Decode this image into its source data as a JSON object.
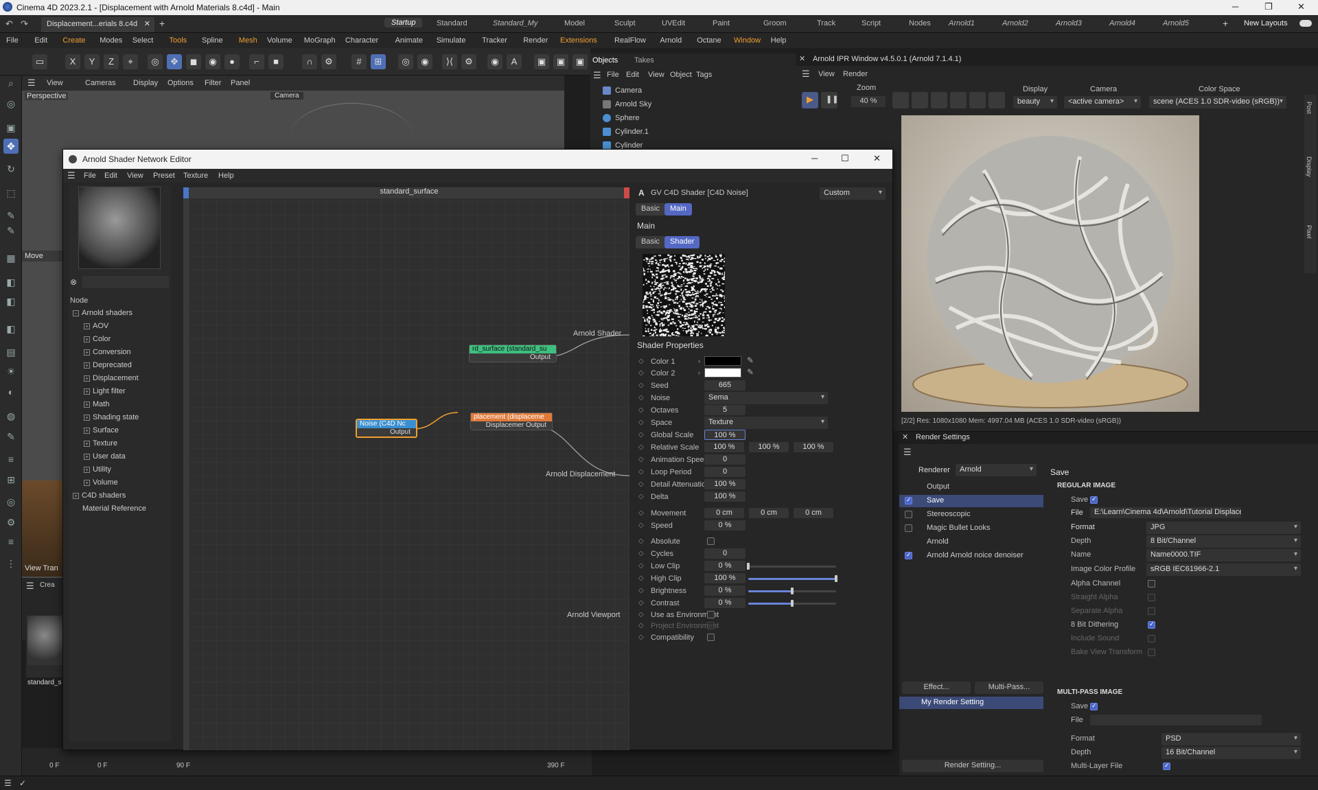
{
  "window_title": "Cinema 4D 2023.2.1 - [Displacement with Arnold Materials 8.c4d] - Main",
  "doc_tab": "Displacement...erials 8.c4d",
  "layouts": [
    "Startup",
    "Standard",
    "Standard_My",
    "Model",
    "Sculpt",
    "UVEdit",
    "Paint",
    "Groom",
    "Track",
    "Script",
    "Nodes",
    "Arnold1",
    "Arnold2",
    "Arnold3",
    "Arnold4",
    "Arnold5"
  ],
  "new_layouts": "New Layouts",
  "menu": [
    "File",
    "Edit",
    "Create",
    "Modes",
    "Select",
    "Tools",
    "Spline",
    "Mesh",
    "Volume",
    "MoGraph",
    "Character",
    "Animate",
    "Simulate",
    "Tracker",
    "Render",
    "Extensions",
    "RealFlow",
    "Arnold",
    "Octane",
    "Window",
    "Help"
  ],
  "viewport": {
    "menu": [
      "View",
      "Cameras",
      "Display",
      "Options",
      "Filter",
      "Panel"
    ],
    "label": "Perspective",
    "camera_tag": "Camera",
    "move_label": "Move",
    "view_tran": "View Tran",
    "create_label": "Crea",
    "mat_label": "standard_s"
  },
  "objects": {
    "tabs": [
      "Objects",
      "Takes"
    ],
    "menu": [
      "File",
      "Edit",
      "View",
      "Object",
      "Tags"
    ],
    "rows": [
      "Camera",
      "Arnold Sky",
      "Sphere",
      "Cylinder.1",
      "Cylinder"
    ]
  },
  "ipr": {
    "title": "Arnold IPR Window v4.5.0.1 (Arnold 7.1.4.1)",
    "menu": [
      "View",
      "Render"
    ],
    "zoom_label": "Zoom",
    "zoom_value": "40 %",
    "display_label": "Display",
    "display_value": "beauty",
    "camera_label": "Camera",
    "camera_value": "<active camera>",
    "colorspace_label": "Color Space",
    "colorspace_value": "scene (ACES 1.0 SDR-video (sRGB))",
    "status": "[2/2]  Res: 1080x1080  Mem: 4997.04 MB  (ACES 1.0 SDR-video (sRGB))",
    "side_tabs": [
      "Post",
      "Display",
      "Pixel"
    ]
  },
  "render_settings": {
    "title": "Render Settings",
    "renderer_label": "Renderer",
    "renderer_value": "Arnold",
    "items": [
      "Output",
      "Save",
      "Stereoscopic",
      "Magic Bullet Looks",
      "Arnold",
      "Arnold Arnold noice denoiser"
    ],
    "effect_btn": "Effect...",
    "multipass_btn": "Multi-Pass...",
    "setting_name": "My Render Setting",
    "render_setting_btn": "Render Setting...",
    "save_title": "Save",
    "regular_image": "REGULAR IMAGE",
    "save_label": "Save",
    "file_label": "File",
    "file_value": "E:\\Learn\\Cinema 4d\\Arnold\\Tutorial Displacement wi",
    "format_label": "Format",
    "format_value": "JPG",
    "depth_label": "Depth",
    "depth_value": "8 Bit/Channel",
    "name_label": "Name",
    "name_value": "Name0000.TIF",
    "icp_label": "Image Color Profile",
    "icp_value": "sRGB IEC61966-2.1",
    "alpha_channel": "Alpha Channel",
    "straight_alpha": "Straight Alpha",
    "separate_alpha": "Separate Alpha",
    "dithering": "8 Bit Dithering",
    "include_sound": "Include Sound",
    "bake_view": "Bake View Transform",
    "multipass_image": "MULTI-PASS IMAGE",
    "mp_save": "Save",
    "mp_file": "File",
    "mp_format_label": "Format",
    "mp_format_value": "PSD",
    "mp_depth_label": "Depth",
    "mp_depth_value": "16 Bit/Channel",
    "mp_multilayer": "Multi-Layer File"
  },
  "shader_editor": {
    "title": "Arnold Shader Network Editor",
    "menu": [
      "File",
      "Edit",
      "View",
      "Preset",
      "Texture",
      "Help"
    ],
    "node_header": "Node",
    "tree": {
      "root": "Arnold shaders",
      "children": [
        "AOV",
        "Color",
        "Conversion",
        "Deprecated",
        "Displacement",
        "Light filter",
        "Math",
        "Shading state",
        "Surface",
        "Texture",
        "User data",
        "Utility",
        "Volume"
      ],
      "c4d": "C4D shaders",
      "matref": "Material Reference"
    },
    "graph_title": "standard_surface",
    "nodes": {
      "surface_title": "rd_surface (standard_su",
      "surface_out": "Output",
      "disp_title": "placement (displaceme",
      "disp_out": "Displacemer Output",
      "noise_title": "Noise (C4D Nc",
      "noise_out": "Output"
    },
    "ports": [
      "Arnold Shader",
      "Arnold Displacement",
      "Arnold Viewport"
    ],
    "attr": {
      "header": "GV C4D Shader [C4D Noise]",
      "mode": "Custom",
      "tabs": [
        "Basic",
        "Main"
      ],
      "section": "Main",
      "sub_tabs": [
        "Basic",
        "Shader"
      ],
      "props_title": "Shader Properties",
      "color1": "Color 1",
      "color2": "Color 2",
      "seed_label": "Seed",
      "seed": "665",
      "noise_label": "Noise",
      "noise": "Sema",
      "octaves_label": "Octaves",
      "octaves": "5",
      "space_label": "Space",
      "space": "Texture",
      "global_scale_label": "Global Scale",
      "global_scale": "100 %",
      "relative_scale_label": "Relative Scale",
      "relative_scale": [
        "100 %",
        "100 %",
        "100 %"
      ],
      "anim_speed_label": "Animation Speed",
      "anim_speed": "0",
      "loop_label": "Loop Period",
      "loop": "0",
      "detail_label": "Detail Attenuation",
      "detail": "100 %",
      "delta_label": "Delta",
      "delta": "100 %",
      "movement_label": "Movement",
      "movement": [
        "0 cm",
        "0 cm",
        "0 cm"
      ],
      "speed_label": "Speed",
      "speed": "0 %",
      "absolute_label": "Absolute",
      "cycles_label": "Cycles",
      "cycles": "0",
      "lowclip_label": "Low Clip",
      "lowclip": "0 %",
      "lowclip_frac": 0.0,
      "highclip_label": "High Clip",
      "highclip": "100 %",
      "highclip_frac": 1.0,
      "brightness_label": "Brightness",
      "brightness": "0 %",
      "brightness_frac": 0.5,
      "contrast_label": "Contrast",
      "contrast": "0 %",
      "contrast_frac": 0.5,
      "use_env_label": "Use as Environment",
      "proj_env_label": "Project Environment",
      "compat_label": "Compatibility"
    }
  },
  "timeline": {
    "start": "0 F",
    "start2": "0 F",
    "mark": "90 F",
    "end": "390 F"
  },
  "colors": {
    "accent": "#5468c4",
    "orange": "#f0a030",
    "active_tab": "#4f6fb5"
  }
}
